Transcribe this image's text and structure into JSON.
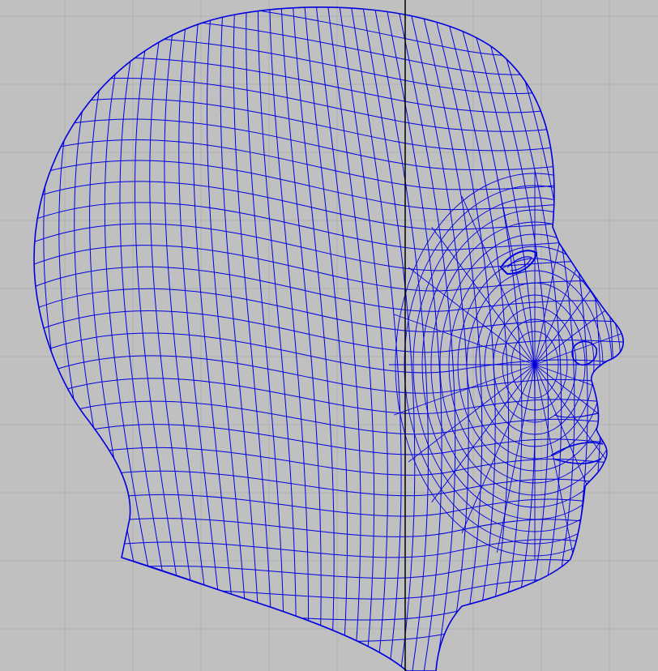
{
  "viewport": {
    "background_color": "#c0c0c0",
    "grid_color": "#b0b0b0",
    "axis_color": "#000000",
    "wireframe_color": "#0000e0",
    "view": "side",
    "mesh_object": "head-wireframe-mesh",
    "grid_visible": true
  }
}
